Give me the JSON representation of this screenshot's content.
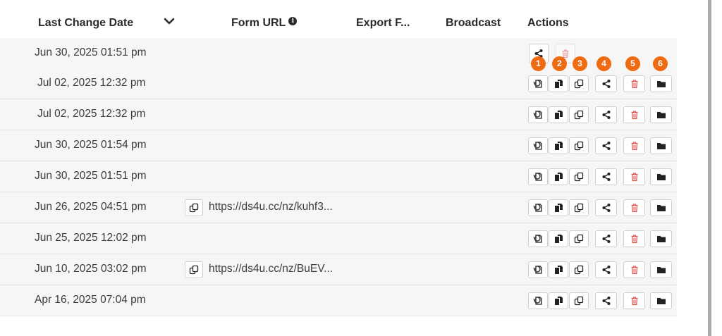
{
  "columns": {
    "last_change_date": "Last Change Date",
    "form_url": "Form URL",
    "export": "Export F...",
    "broadcast": "Broadcast",
    "actions": "Actions"
  },
  "rows": [
    {
      "date": "Jun 30, 2025 01:51 pm",
      "url": "",
      "actions": "partial"
    },
    {
      "date": "Jul 02, 2025 12:32 pm",
      "url": "",
      "actions": "full"
    },
    {
      "date": "Jul 02, 2025 12:32 pm",
      "url": "",
      "actions": "full"
    },
    {
      "date": "Jun 30, 2025 01:54 pm",
      "url": "",
      "actions": "full"
    },
    {
      "date": "Jun 30, 2025 01:51 pm",
      "url": "",
      "actions": "full"
    },
    {
      "date": "Jun 26, 2025 04:51 pm",
      "url": "https://ds4u.cc/nz/kuhf3...",
      "actions": "full"
    },
    {
      "date": "Jun 25, 2025 12:02 pm",
      "url": "",
      "actions": "full"
    },
    {
      "date": "Jun 10, 2025 03:02 pm",
      "url": "https://ds4u.cc/nz/BuEV...",
      "actions": "full"
    },
    {
      "date": "Apr 16, 2025 07:04 pm",
      "url": "",
      "actions": "full"
    }
  ],
  "action_icons": [
    "restore-icon",
    "duplicate-icon",
    "copy-icon",
    "share-icon",
    "trash-icon",
    "folder-icon"
  ],
  "markers": [
    "1",
    "2",
    "3",
    "4",
    "5",
    "6"
  ],
  "colors": {
    "marker": "#f06a12",
    "trash": "#d9534f"
  }
}
